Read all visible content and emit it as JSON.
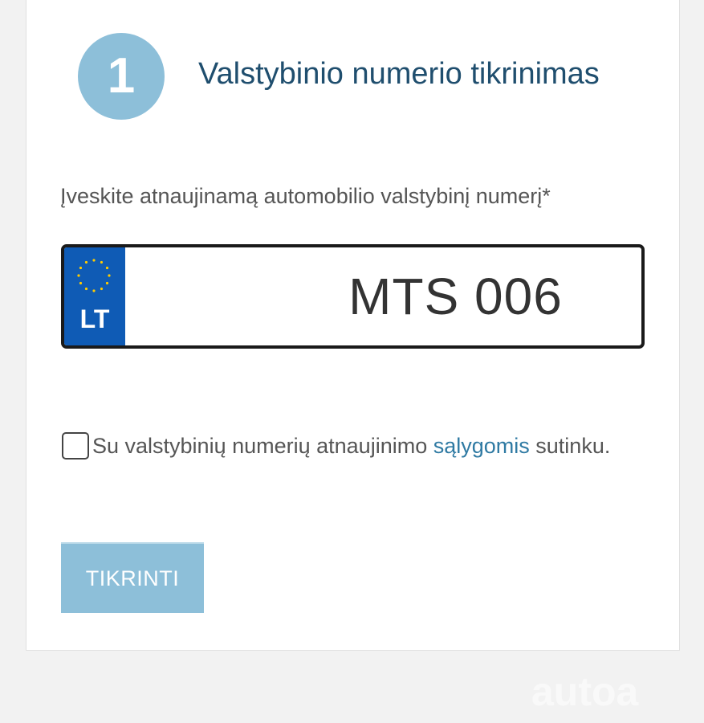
{
  "step": {
    "number": "1",
    "title": "Valstybinio numerio tikrinimas"
  },
  "plate_field": {
    "label": "Įveskite atnaujinamą automobilio valstybinį numerį*",
    "country_code": "LT",
    "value": "MTS 006"
  },
  "terms": {
    "text_before": "Su valstybinių numerių atnaujinimo ",
    "link_text": "sąlygomis",
    "text_after": " sutinku."
  },
  "submit_button": {
    "label": "TIKRINTI"
  },
  "watermark": "autoa",
  "colors": {
    "accent": "#8dbfd9",
    "title": "#1f4e6e",
    "link": "#2f7aa3",
    "eu_blue": "#0f5bb5",
    "eu_stars": "#ffcc00"
  },
  "icons": {
    "eu_flag": "eu-stars-icon",
    "checkbox": "checkbox-unchecked-icon"
  }
}
